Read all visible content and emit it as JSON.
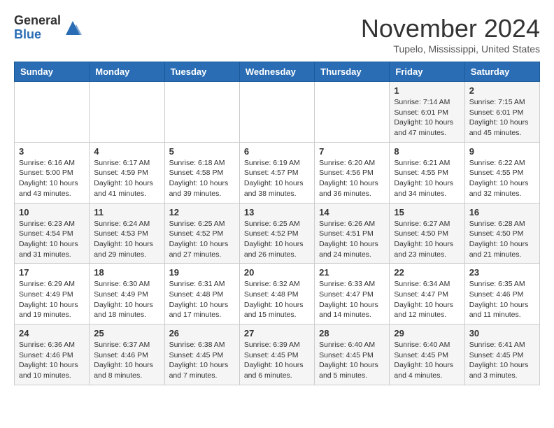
{
  "logo": {
    "general": "General",
    "blue": "Blue"
  },
  "title": "November 2024",
  "location": "Tupelo, Mississippi, United States",
  "days_header": [
    "Sunday",
    "Monday",
    "Tuesday",
    "Wednesday",
    "Thursday",
    "Friday",
    "Saturday"
  ],
  "weeks": [
    [
      {
        "day": "",
        "info": ""
      },
      {
        "day": "",
        "info": ""
      },
      {
        "day": "",
        "info": ""
      },
      {
        "day": "",
        "info": ""
      },
      {
        "day": "",
        "info": ""
      },
      {
        "day": "1",
        "info": "Sunrise: 7:14 AM\nSunset: 6:01 PM\nDaylight: 10 hours\nand 47 minutes."
      },
      {
        "day": "2",
        "info": "Sunrise: 7:15 AM\nSunset: 6:01 PM\nDaylight: 10 hours\nand 45 minutes."
      }
    ],
    [
      {
        "day": "3",
        "info": "Sunrise: 6:16 AM\nSunset: 5:00 PM\nDaylight: 10 hours\nand 43 minutes."
      },
      {
        "day": "4",
        "info": "Sunrise: 6:17 AM\nSunset: 4:59 PM\nDaylight: 10 hours\nand 41 minutes."
      },
      {
        "day": "5",
        "info": "Sunrise: 6:18 AM\nSunset: 4:58 PM\nDaylight: 10 hours\nand 39 minutes."
      },
      {
        "day": "6",
        "info": "Sunrise: 6:19 AM\nSunset: 4:57 PM\nDaylight: 10 hours\nand 38 minutes."
      },
      {
        "day": "7",
        "info": "Sunrise: 6:20 AM\nSunset: 4:56 PM\nDaylight: 10 hours\nand 36 minutes."
      },
      {
        "day": "8",
        "info": "Sunrise: 6:21 AM\nSunset: 4:55 PM\nDaylight: 10 hours\nand 34 minutes."
      },
      {
        "day": "9",
        "info": "Sunrise: 6:22 AM\nSunset: 4:55 PM\nDaylight: 10 hours\nand 32 minutes."
      }
    ],
    [
      {
        "day": "10",
        "info": "Sunrise: 6:23 AM\nSunset: 4:54 PM\nDaylight: 10 hours\nand 31 minutes."
      },
      {
        "day": "11",
        "info": "Sunrise: 6:24 AM\nSunset: 4:53 PM\nDaylight: 10 hours\nand 29 minutes."
      },
      {
        "day": "12",
        "info": "Sunrise: 6:25 AM\nSunset: 4:52 PM\nDaylight: 10 hours\nand 27 minutes."
      },
      {
        "day": "13",
        "info": "Sunrise: 6:25 AM\nSunset: 4:52 PM\nDaylight: 10 hours\nand 26 minutes."
      },
      {
        "day": "14",
        "info": "Sunrise: 6:26 AM\nSunset: 4:51 PM\nDaylight: 10 hours\nand 24 minutes."
      },
      {
        "day": "15",
        "info": "Sunrise: 6:27 AM\nSunset: 4:50 PM\nDaylight: 10 hours\nand 23 minutes."
      },
      {
        "day": "16",
        "info": "Sunrise: 6:28 AM\nSunset: 4:50 PM\nDaylight: 10 hours\nand 21 minutes."
      }
    ],
    [
      {
        "day": "17",
        "info": "Sunrise: 6:29 AM\nSunset: 4:49 PM\nDaylight: 10 hours\nand 19 minutes."
      },
      {
        "day": "18",
        "info": "Sunrise: 6:30 AM\nSunset: 4:49 PM\nDaylight: 10 hours\nand 18 minutes."
      },
      {
        "day": "19",
        "info": "Sunrise: 6:31 AM\nSunset: 4:48 PM\nDaylight: 10 hours\nand 17 minutes."
      },
      {
        "day": "20",
        "info": "Sunrise: 6:32 AM\nSunset: 4:48 PM\nDaylight: 10 hours\nand 15 minutes."
      },
      {
        "day": "21",
        "info": "Sunrise: 6:33 AM\nSunset: 4:47 PM\nDaylight: 10 hours\nand 14 minutes."
      },
      {
        "day": "22",
        "info": "Sunrise: 6:34 AM\nSunset: 4:47 PM\nDaylight: 10 hours\nand 12 minutes."
      },
      {
        "day": "23",
        "info": "Sunrise: 6:35 AM\nSunset: 4:46 PM\nDaylight: 10 hours\nand 11 minutes."
      }
    ],
    [
      {
        "day": "24",
        "info": "Sunrise: 6:36 AM\nSunset: 4:46 PM\nDaylight: 10 hours\nand 10 minutes."
      },
      {
        "day": "25",
        "info": "Sunrise: 6:37 AM\nSunset: 4:46 PM\nDaylight: 10 hours\nand 8 minutes."
      },
      {
        "day": "26",
        "info": "Sunrise: 6:38 AM\nSunset: 4:45 PM\nDaylight: 10 hours\nand 7 minutes."
      },
      {
        "day": "27",
        "info": "Sunrise: 6:39 AM\nSunset: 4:45 PM\nDaylight: 10 hours\nand 6 minutes."
      },
      {
        "day": "28",
        "info": "Sunrise: 6:40 AM\nSunset: 4:45 PM\nDaylight: 10 hours\nand 5 minutes."
      },
      {
        "day": "29",
        "info": "Sunrise: 6:40 AM\nSunset: 4:45 PM\nDaylight: 10 hours\nand 4 minutes."
      },
      {
        "day": "30",
        "info": "Sunrise: 6:41 AM\nSunset: 4:45 PM\nDaylight: 10 hours\nand 3 minutes."
      }
    ]
  ]
}
